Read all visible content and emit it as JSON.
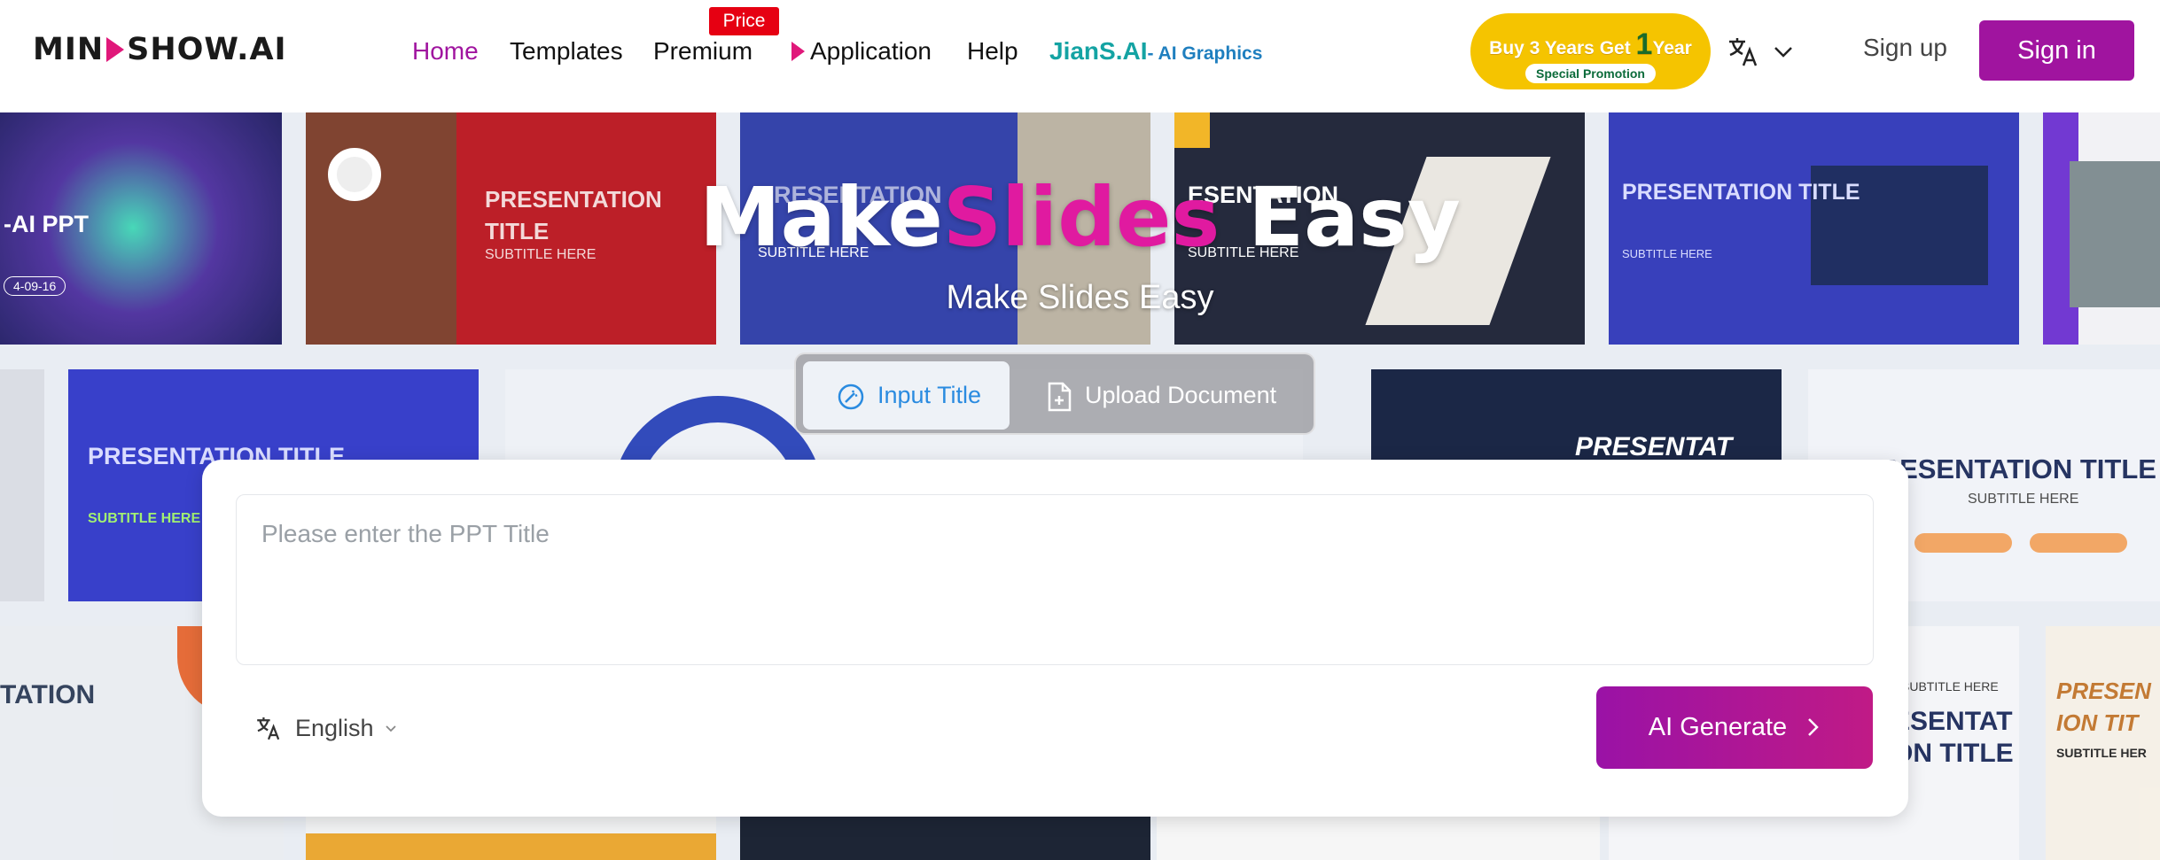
{
  "header": {
    "logo_left": "MIN",
    "logo_right": "SHOW.AI",
    "nav": {
      "home": "Home",
      "templates": "Templates",
      "premium": "Premium",
      "price_badge": "Price",
      "application": "Application",
      "help": "Help",
      "jians": "JianS.AI",
      "jians_sub": "- AI Graphics"
    },
    "promo": {
      "line1_a": "Buy 3 Years Get ",
      "line1_num": "1",
      "line1_b": "Year",
      "line2": "Special Promotion"
    },
    "translate_icon": "translate-icon",
    "signup": "Sign up",
    "signin": "Sign in"
  },
  "hero": {
    "title_a": "Make",
    "title_b": "Slides",
    "title_c": " Easy",
    "subtitle": "Make Slides Easy",
    "tabs": {
      "input_title": "Input Title",
      "upload_document": "Upload Document"
    },
    "background_tiles": [
      {
        "title": "-AI PPT",
        "subtitle": "4-09-16"
      },
      {
        "title": "PRESENTATION TITLE",
        "subtitle": "SUBTITLE HERE"
      },
      {
        "title": "PRESENTATION",
        "subtitle": "SUBTITLE HERE"
      },
      {
        "title": "ESENTATION",
        "subtitle": "SUBTITLE HERE"
      },
      {
        "title": "PRESENTATION TITLE",
        "subtitle": "SUBTITLE HERE"
      },
      {
        "title": "PRESENTATION TITLE",
        "subtitle": "SUBTITLE HERE"
      },
      {
        "title": "PRESENTAT",
        "subtitle": ""
      },
      {
        "title": "PRESENTATION TITLE",
        "subtitle": "SUBTITLE HERE"
      },
      {
        "title": "TATION",
        "subtitle": ""
      },
      {
        "title": "ESENTAT ON TITLE",
        "subtitle": "SUBTITLE HERE"
      },
      {
        "title": "PRESEN ION TIT",
        "subtitle": "SUBTITLE HER"
      }
    ]
  },
  "form": {
    "title_placeholder": "Please enter the PPT Title",
    "language": "English",
    "generate": "AI Generate"
  },
  "colors": {
    "brand": "#a0149f",
    "accent_pink": "#e0187a",
    "tab_active_text": "#2a8be0",
    "promo": "#f5c400"
  }
}
